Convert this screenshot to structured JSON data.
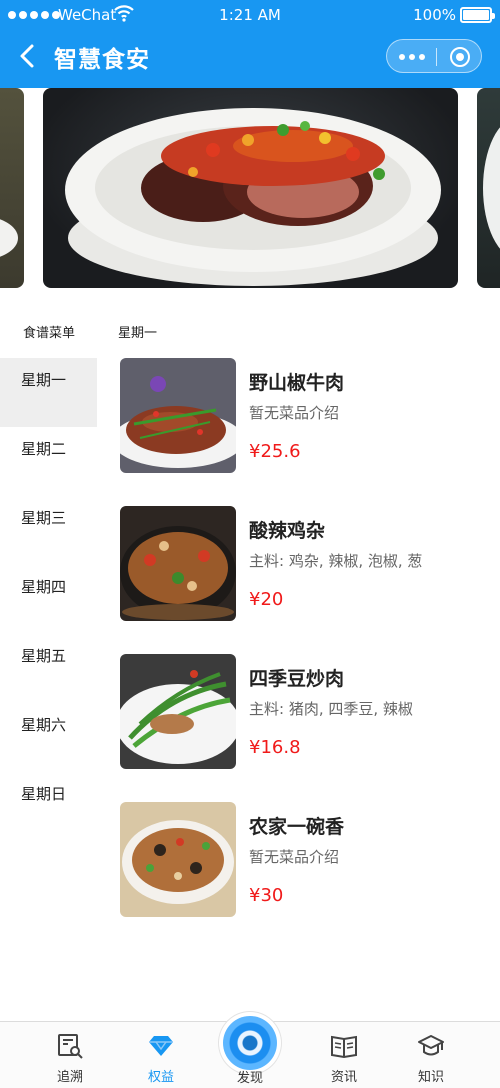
{
  "status_bar": {
    "carrier": "WeChat",
    "time": "1:21 AM",
    "battery": "100%"
  },
  "nav": {
    "title": "智慧食安"
  },
  "menu": {
    "sidebar_title": "食谱菜单",
    "current_day": "星期一",
    "days": [
      "星期一",
      "星期二",
      "星期三",
      "星期四",
      "星期五",
      "星期六",
      "星期日"
    ]
  },
  "dishes": [
    {
      "name": "野山椒牛肉",
      "desc": "暂无菜品介绍",
      "price": "¥25.6"
    },
    {
      "name": "酸辣鸡杂",
      "desc": "主料: 鸡杂, 辣椒, 泡椒, 葱",
      "price": "¥20"
    },
    {
      "name": "四季豆炒肉",
      "desc": "主料: 猪肉, 四季豆, 辣椒",
      "price": "¥16.8"
    },
    {
      "name": "农家一碗香",
      "desc": "暂无菜品介绍",
      "price": "¥30"
    }
  ],
  "tabbar": [
    {
      "label": "追溯",
      "icon": "trace-icon"
    },
    {
      "label": "权益",
      "icon": "diamond-icon",
      "active": true
    },
    {
      "label": "发现",
      "icon": "discover-icon"
    },
    {
      "label": "资讯",
      "icon": "book-icon"
    },
    {
      "label": "知识",
      "icon": "graduation-cap-icon"
    }
  ],
  "colors": {
    "primary": "#1897f2",
    "price": "#f01a1a",
    "active_day_bg": "#eeeeee"
  }
}
